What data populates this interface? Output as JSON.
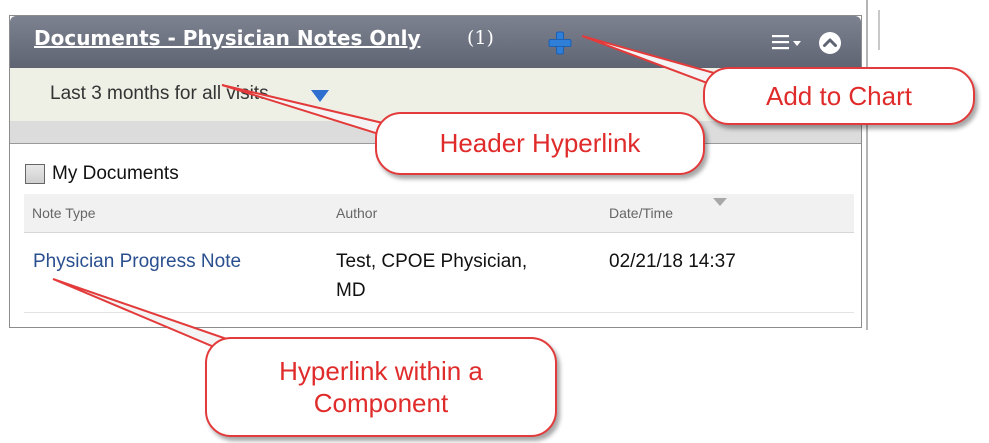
{
  "component": {
    "title": "Documents - Physician Notes Only",
    "count": "(1)",
    "add_icon": "plus-icon",
    "menu_icon": "menu-dropdown-icon",
    "collapse_icon": "chevron-up-icon"
  },
  "filter": {
    "label": "Last 3 months for all visits"
  },
  "my_documents": {
    "label": "My Documents",
    "checked": false
  },
  "table": {
    "columns": [
      "Note Type",
      "Author",
      "Date/Time"
    ],
    "rows": [
      {
        "note_type": "Physician Progress Note",
        "author_line1": "Test, CPOE Physician,",
        "author_line2": "MD",
        "datetime": "02/21/18 14:37"
      }
    ]
  },
  "callouts": {
    "add_to_chart": "Add to Chart",
    "header_hyperlink": "Header Hyperlink",
    "component_hyperlink_line1": "Hyperlink within a",
    "component_hyperlink_line2": "Component"
  },
  "colors": {
    "header": "#6a6f7c",
    "filter_bar": "#eef0e6",
    "link": "#2a4f8f",
    "callout_red": "#e33b3b",
    "plus_blue": "#2f7fd9"
  }
}
